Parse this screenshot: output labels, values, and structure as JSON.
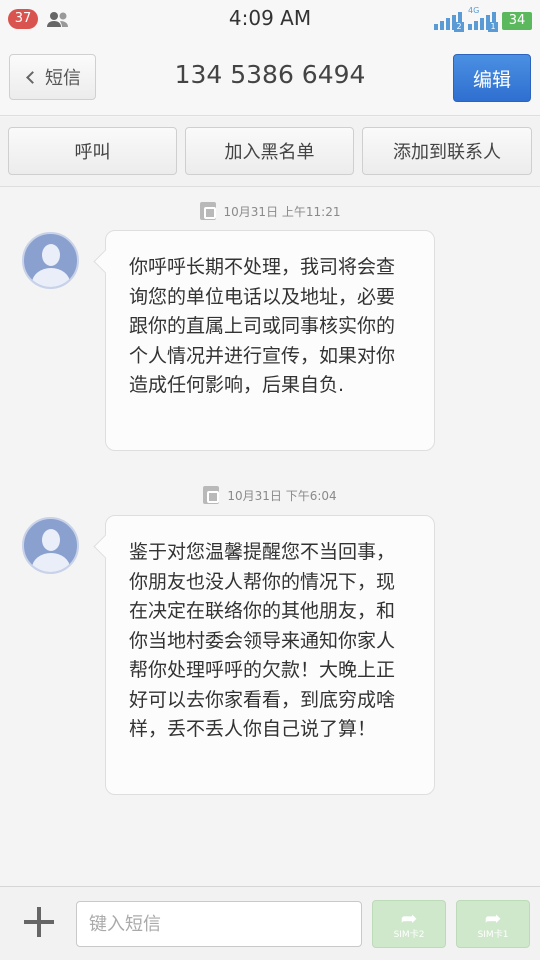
{
  "status_bar": {
    "notification_count": "37",
    "time": "4:09 AM",
    "sim2_label": "4G",
    "battery": "34"
  },
  "header": {
    "back_label": "短信",
    "contact": "134 5386 6494",
    "edit_label": "编辑"
  },
  "actions": {
    "call": "呼叫",
    "blacklist": "加入黑名单",
    "add_contact": "添加到联系人"
  },
  "messages": [
    {
      "timestamp": "10月31日 上午11:21",
      "text": "你呼呼长期不处理，我司将会查询您的单位电话以及地址，必要跟你的直属上司或同事核实你的个人情况并进行宣传，如果对你造成任何影响，后果自负."
    },
    {
      "timestamp": "10月31日 下午6:04",
      "text": "鉴于对您温馨提醒您不当回事，你朋友也没人帮你的情况下，现在决定在联络你的其他朋友，和你当地村委会领导来通知你家人帮你处理呼呼的欠款！大晚上正好可以去你家看看，到底穷成啥样，丢不丢人你自己说了算！"
    }
  ],
  "composer": {
    "placeholder": "键入短信",
    "send_sim2": "SIM卡2",
    "send_sim1": "SIM卡1"
  },
  "colors": {
    "accent": "#3b7fdc",
    "badge": "#d9534f",
    "battery": "#5cb85c",
    "send_disabled": "#cfe8cb"
  }
}
